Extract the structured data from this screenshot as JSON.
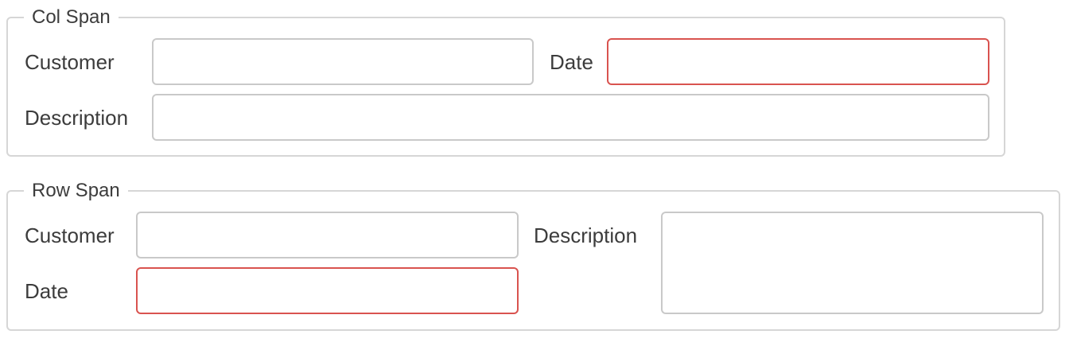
{
  "col_span": {
    "legend": "Col Span",
    "customer_label": "Customer",
    "customer_value": "",
    "date_label": "Date",
    "date_value": "",
    "description_label": "Description",
    "description_value": ""
  },
  "row_span": {
    "legend": "Row Span",
    "customer_label": "Customer",
    "customer_value": "",
    "date_label": "Date",
    "date_value": "",
    "description_label": "Description",
    "description_value": ""
  },
  "colors": {
    "border": "#d6d6d6",
    "input_border": "#c9c9c9",
    "invalid_border": "#d9534f",
    "text": "#3c3c3c"
  }
}
